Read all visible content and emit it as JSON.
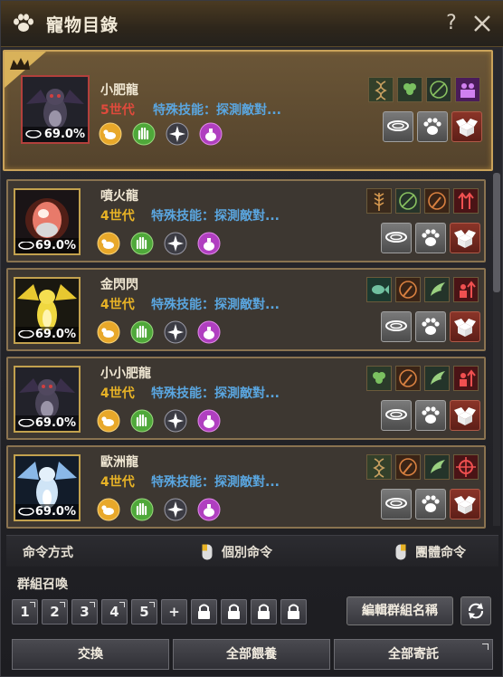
{
  "window": {
    "title": "寵物目錄",
    "help_label": "?",
    "icons": {
      "title": "paw-icon",
      "close": "close-icon"
    }
  },
  "pets": [
    {
      "name": "小肥龍",
      "generation": "5世代",
      "skill": "特殊技能：探測敵對...",
      "hunger": "69.0%"
    },
    {
      "name": "噴火龍",
      "generation": "4世代",
      "skill": "特殊技能：探測敵對...",
      "hunger": "69.0%"
    },
    {
      "name": "金閃閃",
      "generation": "4世代",
      "skill": "特殊技能：探測敵對...",
      "hunger": "69.0%"
    },
    {
      "name": "小小肥龍",
      "generation": "4世代",
      "skill": "特殊技能：探測敵對...",
      "hunger": "69.0%"
    },
    {
      "name": "歐洲龍",
      "generation": "4世代",
      "skill": "特殊技能：探測敵對...",
      "hunger": "69.0%"
    }
  ],
  "command": {
    "label": "命令方式",
    "individual": "個別命令",
    "group": "團體命令"
  },
  "group_summon": {
    "label": "群組召喚",
    "slots": [
      "1",
      "2",
      "3",
      "4",
      "5",
      "+"
    ],
    "edit_label": "編輯群組名稱"
  },
  "bottom": {
    "exchange": "交換",
    "feed_all": "全部餵養",
    "deposit_all": "全部寄託"
  },
  "colors": {
    "gen5": "#e04a3c",
    "gen4": "#e8b326",
    "skill_text": "#5aa6e0",
    "lead_border": "#c9a25a"
  }
}
